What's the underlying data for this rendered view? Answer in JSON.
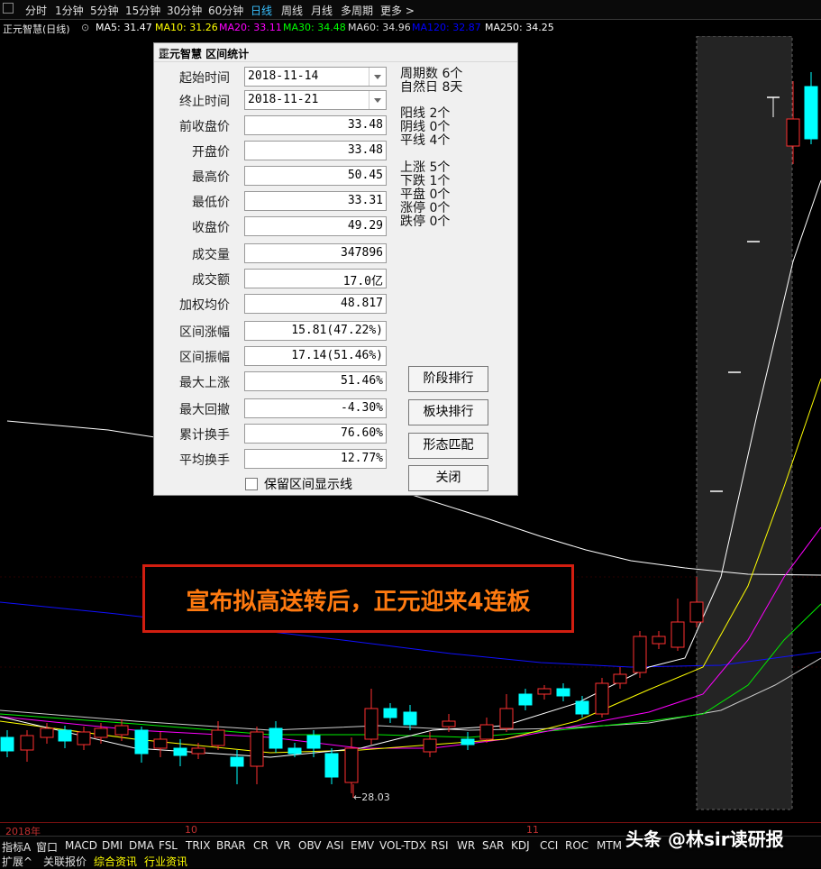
{
  "toolbar": {
    "items": [
      "分时",
      "1分钟",
      "5分钟",
      "15分钟",
      "30分钟",
      "60分钟",
      "日线",
      "周线",
      "月线",
      "多周期",
      "更多 >"
    ],
    "active": "日线"
  },
  "ma_bar": {
    "stock": "正元智慧(日线)",
    "items": [
      {
        "text": "MA5: 31.47",
        "color": "#ffffff"
      },
      {
        "text": "MA10: 31.26",
        "color": "#ffff00"
      },
      {
        "text": "MA20: 33.11",
        "color": "#ff00ff"
      },
      {
        "text": "MA30: 34.48",
        "color": "#00ff00"
      },
      {
        "text": "MA60: 34.96",
        "color": "#dddddd"
      },
      {
        "text": "MA120: 32.87",
        "color": "#0000ff"
      },
      {
        "text": "MA250: 34.25",
        "color": "#ffffff"
      }
    ]
  },
  "dialog": {
    "title": "正元智慧 区间统计",
    "close": "⊠",
    "fields": [
      {
        "label": "起始时间",
        "value": "2018-11-14",
        "type": "select"
      },
      {
        "label": "终止时间",
        "value": "2018-11-21",
        "type": "select"
      },
      {
        "label": "前收盘价",
        "value": "33.48"
      },
      {
        "label": "开盘价",
        "value": "33.48"
      },
      {
        "label": "最高价",
        "value": "50.45"
      },
      {
        "label": "最低价",
        "value": "33.31"
      },
      {
        "label": "收盘价",
        "value": "49.29"
      },
      {
        "label": "成交量",
        "value": "347896"
      },
      {
        "label": "成交额",
        "value": "17.0亿"
      },
      {
        "label": "加权均价",
        "value": "48.817"
      },
      {
        "label": "区间涨幅",
        "value": "15.81(47.22%)"
      },
      {
        "label": "区间振幅",
        "value": "17.14(51.46%)"
      },
      {
        "label": "最大上涨",
        "value": "51.46%"
      },
      {
        "label": "最大回撤",
        "value": "-4.30%"
      },
      {
        "label": "累计换手",
        "value": "76.60%"
      },
      {
        "label": "平均换手",
        "value": "12.77%"
      }
    ],
    "stats_top": [
      {
        "label": "周期数",
        "value": "6个"
      },
      {
        "label": "自然日",
        "value": "8天"
      }
    ],
    "stats_mid": [
      {
        "label": "阳线",
        "value": "2个"
      },
      {
        "label": "阴线",
        "value": "0个"
      },
      {
        "label": "平线",
        "value": "4个"
      }
    ],
    "stats_bot": [
      {
        "label": "上涨",
        "value": "5个"
      },
      {
        "label": "下跌",
        "value": "1个"
      },
      {
        "label": "平盘",
        "value": "0个"
      },
      {
        "label": "涨停",
        "value": "0个"
      },
      {
        "label": "跌停",
        "value": "0个"
      }
    ],
    "buttons": [
      "阶段排行",
      "板块排行",
      "形态匹配",
      "关闭"
    ],
    "checkbox_label": "保留区间显示线"
  },
  "chart": {
    "low_label": "←28.03",
    "date_labels": [
      "2018年",
      "10",
      "11"
    ]
  },
  "banner": "宣布拟高送转后，正元迎来4连板",
  "indicator_bar": [
    "指标A",
    "窗口",
    "MACD",
    "DMI",
    "DMA",
    "FSL",
    "TRIX",
    "BRAR",
    "CR",
    "VR",
    "OBV",
    "ASI",
    "EMV",
    "VOL-TDX",
    "RSI",
    "WR",
    "SAR",
    "KDJ",
    "CCI",
    "ROC",
    "MTM"
  ],
  "bottom_bar": [
    {
      "text": "扩展^",
      "color": "#e0e0e0"
    },
    {
      "text": "关联报价",
      "color": "#e0e0e0"
    },
    {
      "text": "综合资讯",
      "color": "#ffff00"
    },
    {
      "text": "行业资讯",
      "color": "#ffff00"
    }
  ],
  "watermark": "头条 @林sir读研报",
  "colors": {
    "up": "#ff3030",
    "down": "#00ffff",
    "highlight_bg": "#222222"
  }
}
